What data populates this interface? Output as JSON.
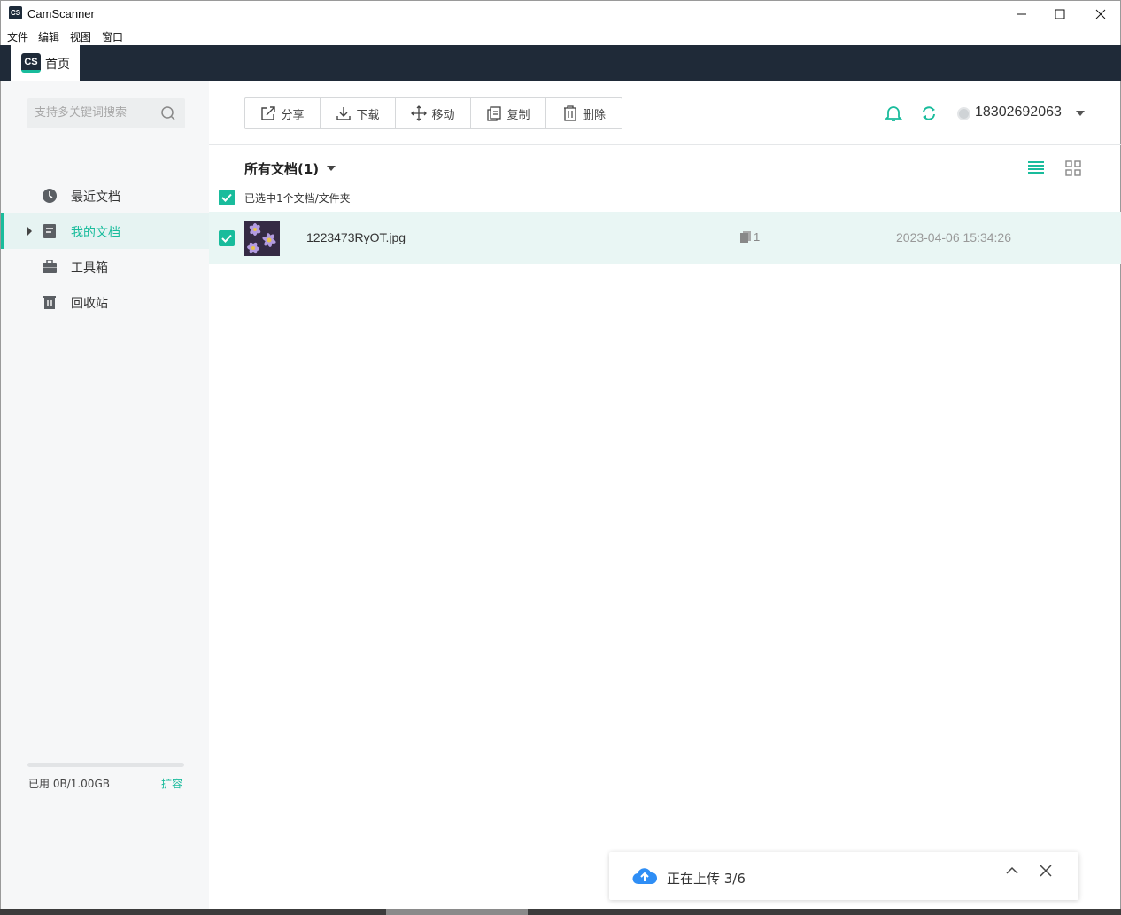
{
  "window": {
    "app_icon_text": "CS",
    "title": "CamScanner"
  },
  "menu": [
    "文件",
    "编辑",
    "视图",
    "窗口"
  ],
  "tabs": {
    "home_logo": "CS",
    "home_label": "首页"
  },
  "sidebar": {
    "search_placeholder": "支持多关键词搜索",
    "items": [
      {
        "label": "最近文档",
        "icon": "clock-icon"
      },
      {
        "label": "我的文档",
        "icon": "document-icon",
        "active": true
      },
      {
        "label": "工具箱",
        "icon": "toolbox-icon"
      },
      {
        "label": "回收站",
        "icon": "trash-icon"
      }
    ],
    "storage": {
      "used_text": "已用 0B/1.00GB",
      "expand_label": "扩容",
      "used_fraction": 0.0
    }
  },
  "toolbar": {
    "share": "分享",
    "download": "下载",
    "move": "移动",
    "copy": "复制",
    "delete": "删除"
  },
  "account": {
    "phone": "18302692063"
  },
  "folder": {
    "title": "所有文档(1)",
    "selected_text": "已选中1个文档/文件夹"
  },
  "files": [
    {
      "name": "1223473RyOT.jpg",
      "pages": "1",
      "date": "2023-04-06 15:34:26",
      "selected": true
    }
  ],
  "upload": {
    "status_text": "正在上传 3/6"
  },
  "colors": {
    "accent": "#19bc9c",
    "tabbar": "#1f2a38",
    "row_selected": "#e9f6f4",
    "upload_icon": "#2f8ef5"
  }
}
